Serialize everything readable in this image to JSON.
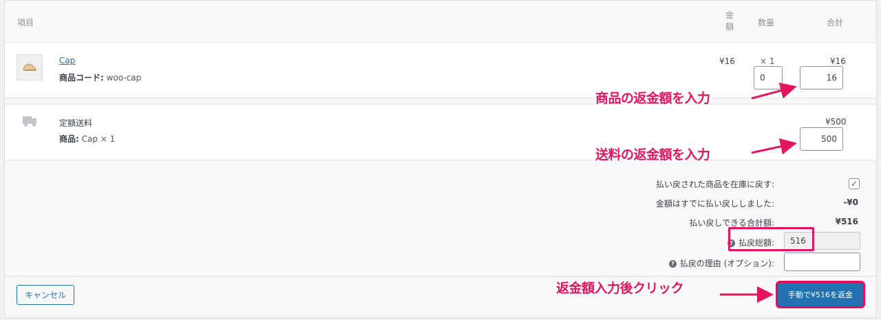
{
  "header": {
    "item": "項目",
    "price": "金額",
    "qty": "数量",
    "total": "合計"
  },
  "line_item": {
    "name": "Cap",
    "sku_label": "商品コード:",
    "sku_value": "woo-cap",
    "price": "¥16",
    "qty": "× 1",
    "total": "¥16",
    "refund_qty": "0",
    "refund_total": "16"
  },
  "shipping": {
    "name": "定額送料",
    "items_label": "商品:",
    "items_value": "Cap × 1",
    "total": "¥500",
    "refund_total": "500"
  },
  "summary": {
    "restock_label": "払い戻された商品を在庫に戻す:",
    "already_refunded_label": "金額はすでに払い戻ししました:",
    "already_refunded_value": "-¥0",
    "available_label": "払い戻しできる合計額:",
    "available_value": "¥516",
    "refund_amount_label": "払戻総額:",
    "refund_amount_value": "516",
    "reason_label": "払戻の理由 (オプション):",
    "reason_value": ""
  },
  "buttons": {
    "cancel": "キャンセル",
    "refund_manual": "手動で¥516を返金"
  },
  "annotations": {
    "item_refund": "商品の返金額を入力",
    "shipping_refund": "送料の返金額を入力",
    "click_after": "返金額入力後クリック"
  },
  "colors": {
    "accent": "#2271b1",
    "annotation": "#e3155f"
  }
}
